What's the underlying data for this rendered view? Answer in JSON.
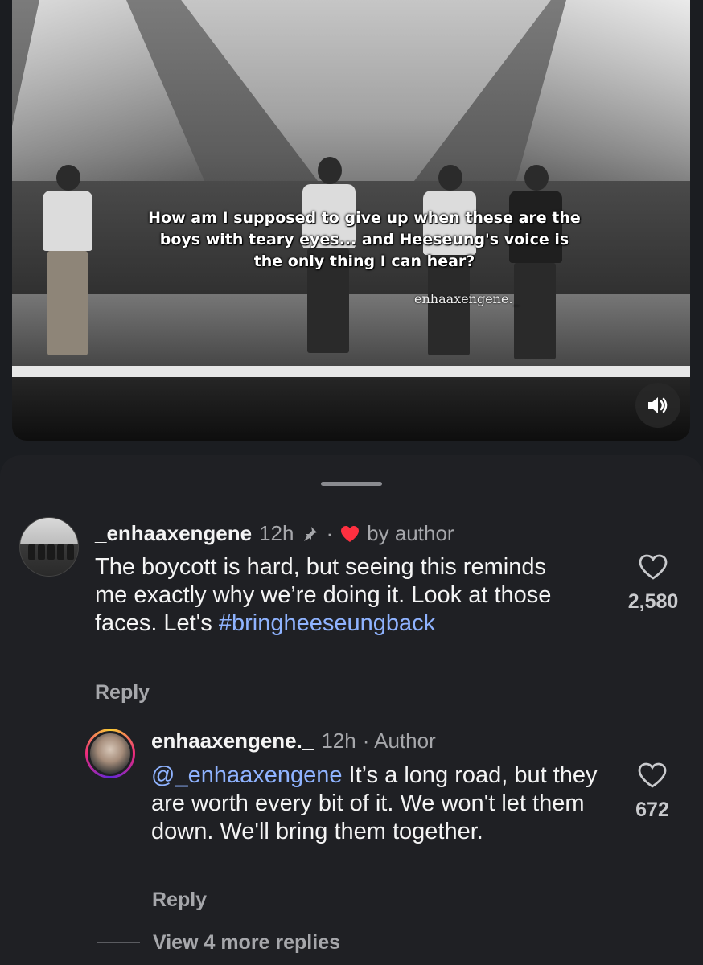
{
  "video": {
    "caption_line1": "How am I supposed to give up when these are the",
    "caption_line2": "boys with teary eyes... and Heeseung's voice is",
    "caption_line3": "the only thing I can hear?",
    "watermark": "enhaaxengene._",
    "sound_icon": "volume-on-icon"
  },
  "comments": {
    "main": {
      "username": "_enhaaxengene",
      "time": "12h",
      "pin_icon": "pin-icon",
      "separator": "·",
      "heart_icon": "red-heart-icon",
      "by_author": "by author",
      "text_part": "The boycott is hard, but seeing this reminds me exactly why we’re doing it. Look at those faces. Let's",
      "hashtag": "#bringheeseungback",
      "like_count": "2,580",
      "reply_label": "Reply"
    },
    "reply": {
      "username": "enhaaxengene._",
      "time": "12h",
      "author_tag": "· Author",
      "mention": "@_enhaaxengene",
      "text_part": "It’s a long road, but they are worth every bit of it. We won't let them down. We'll bring them together.",
      "like_count": "672",
      "reply_label": "Reply"
    },
    "view_more": "View 4 more replies"
  },
  "colors": {
    "background": "#1f2024",
    "link_blue": "#8fb3ff",
    "heart_red": "#ff3040",
    "muted_text": "#a6a7ab"
  }
}
